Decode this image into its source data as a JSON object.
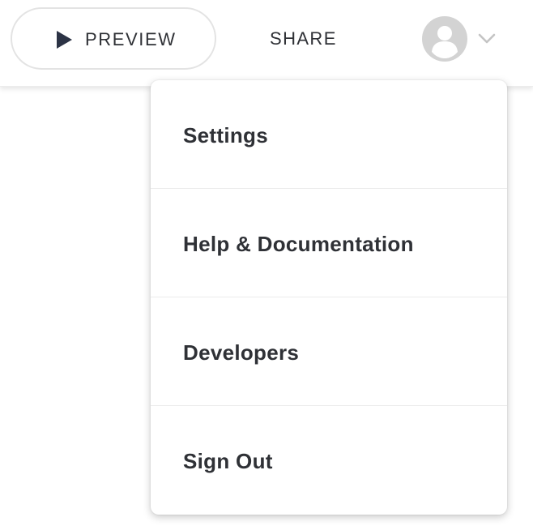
{
  "toolbar": {
    "preview_label": "PREVIEW",
    "share_label": "SHARE"
  },
  "icons": {
    "play": "play-icon",
    "avatar": "user-avatar-icon",
    "chevron": "chevron-down-icon"
  },
  "colors": {
    "play_icon": "#2c3345",
    "avatar_bg": "#d3d3d3",
    "chevron": "#c4c4c4"
  },
  "menu": {
    "items": [
      {
        "label": "Settings"
      },
      {
        "label": "Help & Documentation"
      },
      {
        "label": "Developers"
      },
      {
        "label": "Sign Out"
      }
    ]
  }
}
